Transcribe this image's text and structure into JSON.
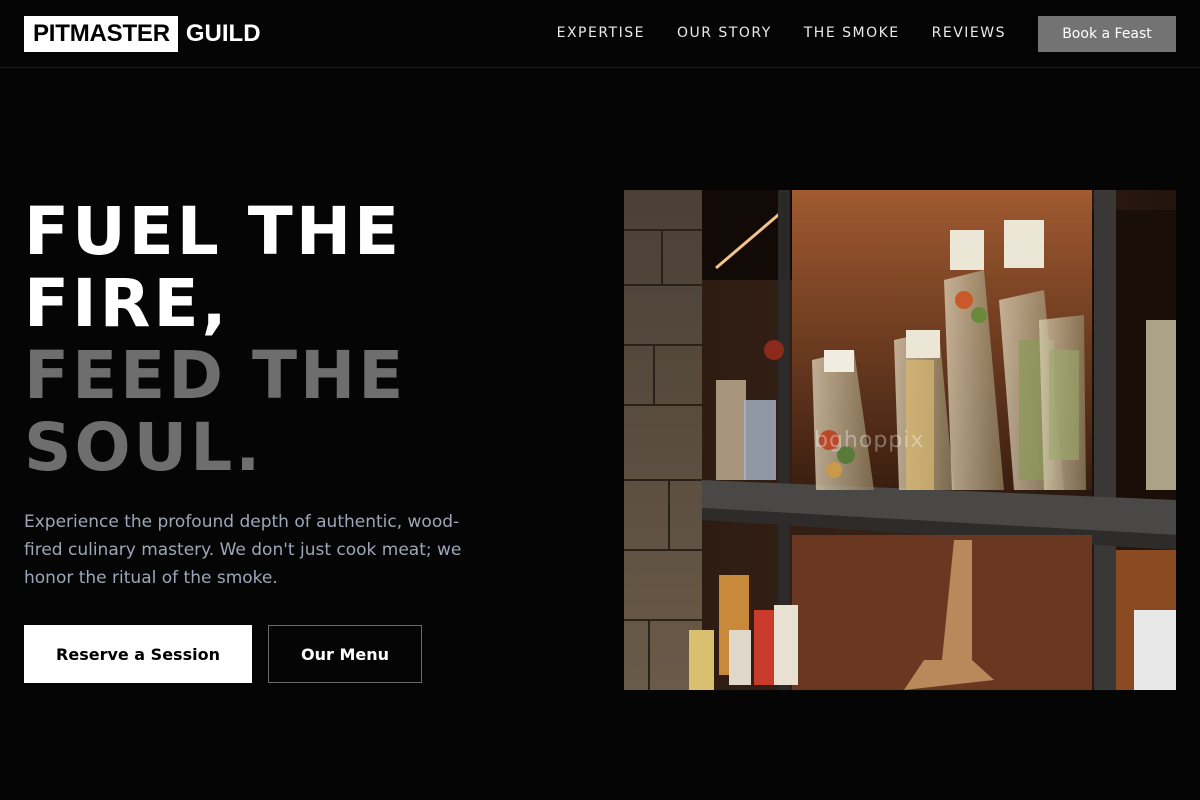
{
  "brand": {
    "logo_box": "PITMASTER",
    "logo_text": "GUILD"
  },
  "nav": {
    "links": [
      "EXPERTISE",
      "OUR STORY",
      "THE SMOKE",
      "REVIEWS"
    ],
    "cta": "Book a Feast"
  },
  "hero": {
    "title_line1": "FUEL THE",
    "title_line2": "FIRE,",
    "title_line3": "FEED THE",
    "title_line4": "SOUL.",
    "subtitle": "Experience the profound depth of authentic, wood-fired culinary mastery. We don't just cook meat; we honor the ritual of the smoke.",
    "primary_button": "Reserve a Session",
    "secondary_button": "Our Menu",
    "image_watermark": "bghoppix"
  },
  "colors": {
    "background": "#050505",
    "primary_text": "#ffffff",
    "muted_title": "#6e6e6e",
    "subtitle": "#9ea6b8",
    "nav_cta_bg": "#737373"
  }
}
